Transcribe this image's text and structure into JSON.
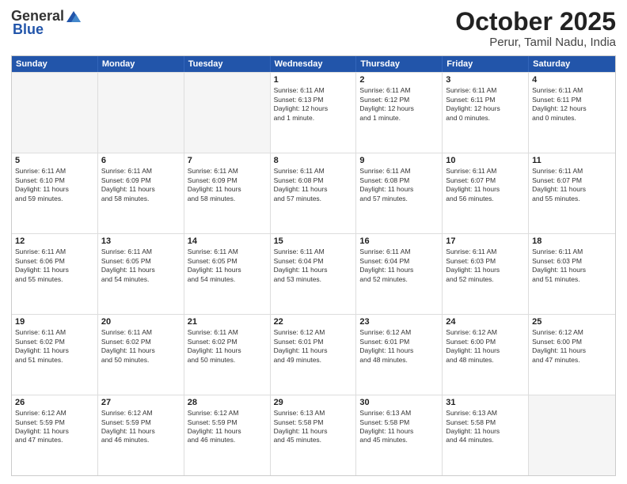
{
  "header": {
    "logo": {
      "general": "General",
      "blue": "Blue"
    },
    "month": "October 2025",
    "location": "Perur, Tamil Nadu, India"
  },
  "weekdays": [
    "Sunday",
    "Monday",
    "Tuesday",
    "Wednesday",
    "Thursday",
    "Friday",
    "Saturday"
  ],
  "rows": [
    [
      {
        "day": "",
        "text": ""
      },
      {
        "day": "",
        "text": ""
      },
      {
        "day": "",
        "text": ""
      },
      {
        "day": "1",
        "text": "Sunrise: 6:11 AM\nSunset: 6:13 PM\nDaylight: 12 hours\nand 1 minute."
      },
      {
        "day": "2",
        "text": "Sunrise: 6:11 AM\nSunset: 6:12 PM\nDaylight: 12 hours\nand 1 minute."
      },
      {
        "day": "3",
        "text": "Sunrise: 6:11 AM\nSunset: 6:11 PM\nDaylight: 12 hours\nand 0 minutes."
      },
      {
        "day": "4",
        "text": "Sunrise: 6:11 AM\nSunset: 6:11 PM\nDaylight: 12 hours\nand 0 minutes."
      }
    ],
    [
      {
        "day": "5",
        "text": "Sunrise: 6:11 AM\nSunset: 6:10 PM\nDaylight: 11 hours\nand 59 minutes."
      },
      {
        "day": "6",
        "text": "Sunrise: 6:11 AM\nSunset: 6:09 PM\nDaylight: 11 hours\nand 58 minutes."
      },
      {
        "day": "7",
        "text": "Sunrise: 6:11 AM\nSunset: 6:09 PM\nDaylight: 11 hours\nand 58 minutes."
      },
      {
        "day": "8",
        "text": "Sunrise: 6:11 AM\nSunset: 6:08 PM\nDaylight: 11 hours\nand 57 minutes."
      },
      {
        "day": "9",
        "text": "Sunrise: 6:11 AM\nSunset: 6:08 PM\nDaylight: 11 hours\nand 57 minutes."
      },
      {
        "day": "10",
        "text": "Sunrise: 6:11 AM\nSunset: 6:07 PM\nDaylight: 11 hours\nand 56 minutes."
      },
      {
        "day": "11",
        "text": "Sunrise: 6:11 AM\nSunset: 6:07 PM\nDaylight: 11 hours\nand 55 minutes."
      }
    ],
    [
      {
        "day": "12",
        "text": "Sunrise: 6:11 AM\nSunset: 6:06 PM\nDaylight: 11 hours\nand 55 minutes."
      },
      {
        "day": "13",
        "text": "Sunrise: 6:11 AM\nSunset: 6:05 PM\nDaylight: 11 hours\nand 54 minutes."
      },
      {
        "day": "14",
        "text": "Sunrise: 6:11 AM\nSunset: 6:05 PM\nDaylight: 11 hours\nand 54 minutes."
      },
      {
        "day": "15",
        "text": "Sunrise: 6:11 AM\nSunset: 6:04 PM\nDaylight: 11 hours\nand 53 minutes."
      },
      {
        "day": "16",
        "text": "Sunrise: 6:11 AM\nSunset: 6:04 PM\nDaylight: 11 hours\nand 52 minutes."
      },
      {
        "day": "17",
        "text": "Sunrise: 6:11 AM\nSunset: 6:03 PM\nDaylight: 11 hours\nand 52 minutes."
      },
      {
        "day": "18",
        "text": "Sunrise: 6:11 AM\nSunset: 6:03 PM\nDaylight: 11 hours\nand 51 minutes."
      }
    ],
    [
      {
        "day": "19",
        "text": "Sunrise: 6:11 AM\nSunset: 6:02 PM\nDaylight: 11 hours\nand 51 minutes."
      },
      {
        "day": "20",
        "text": "Sunrise: 6:11 AM\nSunset: 6:02 PM\nDaylight: 11 hours\nand 50 minutes."
      },
      {
        "day": "21",
        "text": "Sunrise: 6:11 AM\nSunset: 6:02 PM\nDaylight: 11 hours\nand 50 minutes."
      },
      {
        "day": "22",
        "text": "Sunrise: 6:12 AM\nSunset: 6:01 PM\nDaylight: 11 hours\nand 49 minutes."
      },
      {
        "day": "23",
        "text": "Sunrise: 6:12 AM\nSunset: 6:01 PM\nDaylight: 11 hours\nand 48 minutes."
      },
      {
        "day": "24",
        "text": "Sunrise: 6:12 AM\nSunset: 6:00 PM\nDaylight: 11 hours\nand 48 minutes."
      },
      {
        "day": "25",
        "text": "Sunrise: 6:12 AM\nSunset: 6:00 PM\nDaylight: 11 hours\nand 47 minutes."
      }
    ],
    [
      {
        "day": "26",
        "text": "Sunrise: 6:12 AM\nSunset: 5:59 PM\nDaylight: 11 hours\nand 47 minutes."
      },
      {
        "day": "27",
        "text": "Sunrise: 6:12 AM\nSunset: 5:59 PM\nDaylight: 11 hours\nand 46 minutes."
      },
      {
        "day": "28",
        "text": "Sunrise: 6:12 AM\nSunset: 5:59 PM\nDaylight: 11 hours\nand 46 minutes."
      },
      {
        "day": "29",
        "text": "Sunrise: 6:13 AM\nSunset: 5:58 PM\nDaylight: 11 hours\nand 45 minutes."
      },
      {
        "day": "30",
        "text": "Sunrise: 6:13 AM\nSunset: 5:58 PM\nDaylight: 11 hours\nand 45 minutes."
      },
      {
        "day": "31",
        "text": "Sunrise: 6:13 AM\nSunset: 5:58 PM\nDaylight: 11 hours\nand 44 minutes."
      },
      {
        "day": "",
        "text": ""
      }
    ]
  ]
}
